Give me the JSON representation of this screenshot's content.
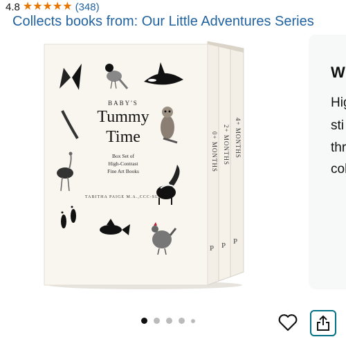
{
  "rating": {
    "value": "4.8",
    "stars": "★★★★★",
    "count": "(348)"
  },
  "series_link": "Collects books from: Our Little Adventures Series",
  "side_card": {
    "title": "Wh",
    "lines": [
      "Hig",
      "sti",
      "thr",
      "col"
    ]
  },
  "product": {
    "cover_top_label": "BABY'S",
    "cover_title_1": "Tummy",
    "cover_title_2": "Time",
    "cover_subtitle_1": "Box Set of",
    "cover_subtitle_2": "High-Contrast",
    "cover_subtitle_3": "Fine Art Books",
    "cover_author": "TABITHA PAIGE M.A.,CCC-SLP",
    "spine_1": "0+ MONTHS",
    "spine_2": "2+ MONTHS",
    "spine_3": "4+ MONTHS"
  },
  "carousel": {
    "count": 5,
    "active_index": 0
  },
  "colors": {
    "link": "#2162a1",
    "star": "#e77600",
    "share_border": "#007185"
  },
  "icons": {
    "favorite": "heart-icon",
    "share": "share-icon"
  }
}
